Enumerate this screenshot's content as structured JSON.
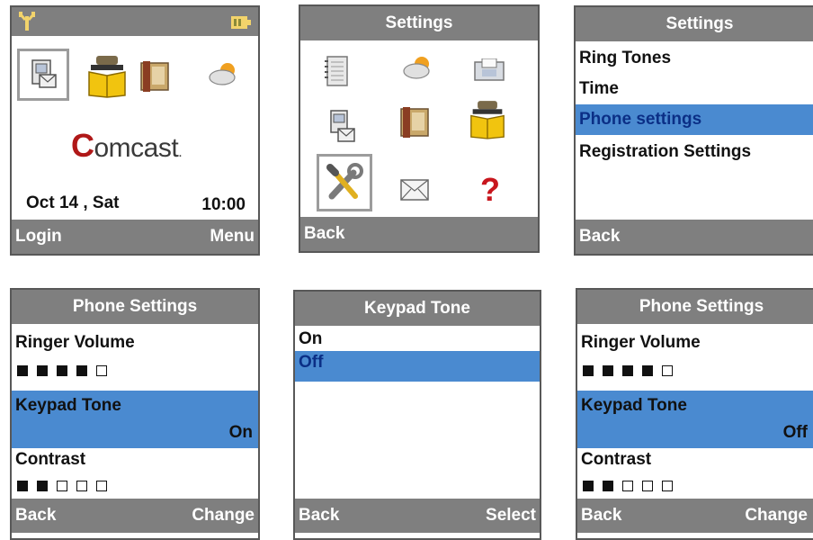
{
  "screen1": {
    "logo": "comcast",
    "date": "Oct 14 , Sat",
    "time": "10:00",
    "soft_left": "Login",
    "soft_right": "Menu",
    "icons": [
      "signal-icon",
      "battery-icon",
      "address-book-icon",
      "phonebook-icon",
      "notes-icon",
      "weather-icon"
    ]
  },
  "screen2": {
    "title": "Settings",
    "soft_left": "Back",
    "icons": [
      "notebook-icon",
      "weather-icon",
      "fax-icon",
      "address-book-icon",
      "notes-icon",
      "phonebook-icon",
      "settings-tools-icon",
      "mail-icon",
      "help-icon"
    ]
  },
  "screen3": {
    "title": "Settings",
    "items": [
      "Ring Tones",
      "Time",
      "Phone settings",
      "Registration Settings"
    ],
    "selected_index": 2,
    "soft_left": "Back"
  },
  "screen4": {
    "title": "Phone Settings",
    "ringer_label": "Ringer Volume",
    "ringer_level": 4,
    "keypad_label": "Keypad Tone",
    "keypad_value": "On",
    "contrast_label": "Contrast",
    "contrast_level": 2,
    "soft_left": "Back",
    "soft_right": "Change"
  },
  "screen5": {
    "title": "Keypad Tone",
    "options": [
      "On",
      "Off"
    ],
    "selected_index": 1,
    "soft_left": "Back",
    "soft_right": "Select"
  },
  "screen6": {
    "title": "Phone Settings",
    "ringer_label": "Ringer Volume",
    "ringer_level": 4,
    "keypad_label": "Keypad Tone",
    "keypad_value": "Off",
    "contrast_label": "Contrast",
    "contrast_level": 2,
    "soft_left": "Back",
    "soft_right": "Change"
  },
  "colors": {
    "bar": "#7f7f7f",
    "highlight": "#4a8ad0",
    "highlight_text": "#0b2f86",
    "logo_red": "#b01818"
  }
}
